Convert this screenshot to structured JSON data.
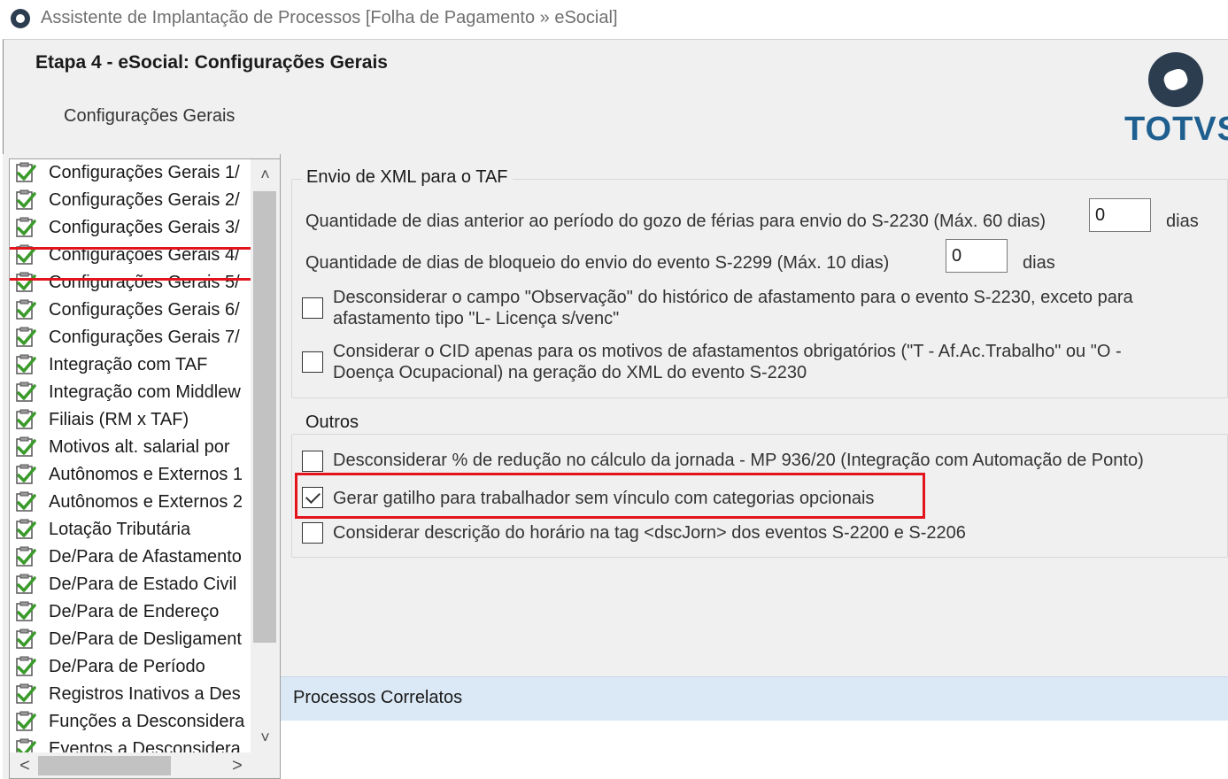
{
  "window": {
    "title": "Assistente de Implantação de Processos [Folha de Pagamento » eSocial]",
    "icon": "totvs-app-icon"
  },
  "header": {
    "step_title": "Etapa 4 - eSocial: Configurações Gerais",
    "subtitle": "Configurações Gerais",
    "logo_text": "TOTVS"
  },
  "sidebar": {
    "selected_index": 3,
    "items": [
      {
        "label": "Configurações Gerais 1/",
        "icon": "green-check-icon"
      },
      {
        "label": "Configurações Gerais 2/",
        "icon": "green-check-icon"
      },
      {
        "label": "Configurações Gerais 3/",
        "icon": "green-check-icon"
      },
      {
        "label": "Configurações Gerais 4/",
        "icon": "green-check-icon"
      },
      {
        "label": "Configurações Gerais 5/",
        "icon": "green-check-icon"
      },
      {
        "label": "Configurações Gerais 6/",
        "icon": "green-check-icon"
      },
      {
        "label": "Configurações Gerais 7/",
        "icon": "green-check-icon"
      },
      {
        "label": "Integração com TAF",
        "icon": "green-check-icon"
      },
      {
        "label": "Integração com Middlew",
        "icon": "green-check-icon"
      },
      {
        "label": "Filiais (RM x TAF)",
        "icon": "green-check-icon"
      },
      {
        "label": "Motivos alt. salarial por",
        "icon": "green-check-icon"
      },
      {
        "label": "Autônomos e Externos 1",
        "icon": "green-check-icon"
      },
      {
        "label": "Autônomos e Externos 2",
        "icon": "green-check-icon"
      },
      {
        "label": "Lotação Tributária",
        "icon": "green-check-icon"
      },
      {
        "label": "De/Para de Afastamento",
        "icon": "green-check-icon"
      },
      {
        "label": "De/Para de Estado Civil",
        "icon": "green-check-icon"
      },
      {
        "label": "De/Para de Endereço",
        "icon": "green-check-icon"
      },
      {
        "label": "De/Para de Desligament",
        "icon": "green-check-icon"
      },
      {
        "label": "De/Para de Período",
        "icon": "green-check-icon"
      },
      {
        "label": "Registros Inativos a Des",
        "icon": "green-check-icon"
      },
      {
        "label": "Funções a Desconsidera",
        "icon": "green-check-icon"
      },
      {
        "label": "Eventos a Desconsidera",
        "icon": "green-check-icon"
      }
    ],
    "vscroll_up": "˄",
    "vscroll_down": "˅",
    "hscroll_left": "<",
    "hscroll_right": ">"
  },
  "xml_group": {
    "title": "Envio de XML para o TAF",
    "ferias_label": "Quantidade de dias anterior ao período do gozo de férias para envio do S-2230 (Máx. 60 dias)",
    "ferias_value": "0",
    "ferias_unit": "dias",
    "bloqueio_label": "Quantidade de dias de bloqueio do envio do evento S-2299 (Máx. 10 dias)",
    "bloqueio_value": "0",
    "bloqueio_unit": "dias",
    "cb_observacao_line1": "Desconsiderar o campo \"Observação\" do histórico de afastamento para o evento S-2230, exceto para",
    "cb_observacao_line2": "afastamento tipo \"L- Licença s/venc\"",
    "cb_observacao_checked": false,
    "cb_cid_line1": "Considerar o CID apenas para os motivos de afastamentos obrigatórios (\"T - Af.Ac.Trabalho\" ou \"O -",
    "cb_cid_line2": "Doença Ocupacional) na geração do XML do evento S-2230",
    "cb_cid_checked": false
  },
  "outros_group": {
    "title": "Outros",
    "cb_reducao": "Desconsiderar % de redução no cálculo da jornada - MP 936/20 (Integração com Automação de Ponto)",
    "cb_reducao_checked": false,
    "cb_gatilho": "Gerar gatilho para trabalhador sem vínculo com categorias opcionais",
    "cb_gatilho_checked": true,
    "cb_horario": "Considerar descrição do horário na tag <dscJorn> dos eventos S-2200 e S-2206",
    "cb_horario_checked": false
  },
  "correlatos": {
    "label": "Processos Correlatos"
  },
  "colors": {
    "highlight_red": "#e3141c",
    "panel_bg": "#f0f0f0",
    "correlatos_bg": "#dbe9f6",
    "logo_blue": "#1f5f8f",
    "check_green": "#3a9a2a"
  }
}
